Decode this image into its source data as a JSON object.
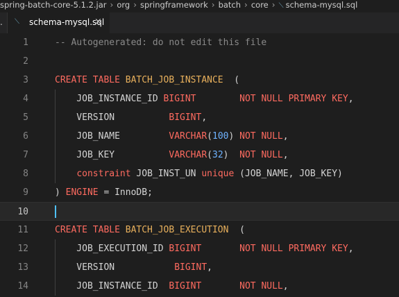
{
  "breadcrumb": {
    "items": [
      {
        "label": "spring-batch-core-5.1.2.jar"
      },
      {
        "label": "org"
      },
      {
        "label": "springframework"
      },
      {
        "label": "batch"
      },
      {
        "label": "core"
      },
      {
        "label": "schema-mysql.sql"
      }
    ],
    "separator": "›"
  },
  "tabs": {
    "overflow": ".",
    "active": {
      "label": "schema-mysql.sql",
      "close": "×"
    }
  },
  "editor": {
    "active_line": 10,
    "colors": {
      "comment": "#8a8a8a",
      "keyword": "#ff6b60",
      "name": "#e8b05c",
      "number": "#6fb3ff",
      "plain": "#d4d4d4",
      "cursor": "#4fc1ff"
    },
    "lines": [
      {
        "number": "1",
        "tokens": [
          {
            "t": "comment",
            "v": "-- Autogenerated: do not edit this file"
          }
        ]
      },
      {
        "number": "2",
        "tokens": []
      },
      {
        "number": "3",
        "tokens": [
          {
            "t": "kw",
            "v": "CREATE TABLE "
          },
          {
            "t": "name",
            "v": "BATCH_JOB_INSTANCE"
          },
          {
            "t": "plain",
            "v": "  ("
          }
        ]
      },
      {
        "number": "4",
        "tokens": [
          {
            "t": "plain",
            "v": "    JOB_INSTANCE_ID "
          },
          {
            "t": "kw",
            "v": "BIGINT"
          },
          {
            "t": "plain",
            "v": "        "
          },
          {
            "t": "kw",
            "v": "NOT NULL PRIMARY KEY"
          },
          {
            "t": "plain",
            "v": ","
          }
        ]
      },
      {
        "number": "5",
        "tokens": [
          {
            "t": "plain",
            "v": "    VERSION          "
          },
          {
            "t": "kw",
            "v": "BIGINT"
          },
          {
            "t": "plain",
            "v": ","
          }
        ]
      },
      {
        "number": "6",
        "tokens": [
          {
            "t": "plain",
            "v": "    JOB_NAME         "
          },
          {
            "t": "kw",
            "v": "VARCHAR"
          },
          {
            "t": "plain",
            "v": "("
          },
          {
            "t": "num",
            "v": "100"
          },
          {
            "t": "plain",
            "v": ") "
          },
          {
            "t": "kw",
            "v": "NOT NULL"
          },
          {
            "t": "plain",
            "v": ","
          }
        ]
      },
      {
        "number": "7",
        "tokens": [
          {
            "t": "plain",
            "v": "    JOB_KEY          "
          },
          {
            "t": "kw",
            "v": "VARCHAR"
          },
          {
            "t": "plain",
            "v": "("
          },
          {
            "t": "num",
            "v": "32"
          },
          {
            "t": "plain",
            "v": ")  "
          },
          {
            "t": "kw",
            "v": "NOT NULL"
          },
          {
            "t": "plain",
            "v": ","
          }
        ]
      },
      {
        "number": "8",
        "tokens": [
          {
            "t": "plain",
            "v": "    "
          },
          {
            "t": "kw",
            "v": "constraint"
          },
          {
            "t": "plain",
            "v": " JOB_INST_UN "
          },
          {
            "t": "kw",
            "v": "unique"
          },
          {
            "t": "plain",
            "v": " (JOB_NAME, JOB_KEY)"
          }
        ]
      },
      {
        "number": "9",
        "tokens": [
          {
            "t": "plain",
            "v": ") "
          },
          {
            "t": "kw",
            "v": "ENGINE"
          },
          {
            "t": "plain",
            "v": " = InnoDB;"
          }
        ]
      },
      {
        "number": "10",
        "tokens": []
      },
      {
        "number": "11",
        "tokens": [
          {
            "t": "kw",
            "v": "CREATE TABLE "
          },
          {
            "t": "name",
            "v": "BATCH_JOB_EXECUTION"
          },
          {
            "t": "plain",
            "v": "  ("
          }
        ]
      },
      {
        "number": "12",
        "tokens": [
          {
            "t": "plain",
            "v": "    JOB_EXECUTION_ID "
          },
          {
            "t": "kw",
            "v": "BIGINT"
          },
          {
            "t": "plain",
            "v": "       "
          },
          {
            "t": "kw",
            "v": "NOT NULL PRIMARY KEY"
          },
          {
            "t": "plain",
            "v": ","
          }
        ]
      },
      {
        "number": "13",
        "tokens": [
          {
            "t": "plain",
            "v": "    VERSION           "
          },
          {
            "t": "kw",
            "v": "BIGINT"
          },
          {
            "t": "plain",
            "v": ","
          }
        ]
      },
      {
        "number": "14",
        "tokens": [
          {
            "t": "plain",
            "v": "    JOB_INSTANCE_ID  "
          },
          {
            "t": "kw",
            "v": "BIGINT"
          },
          {
            "t": "plain",
            "v": "       "
          },
          {
            "t": "kw",
            "v": "NOT NULL"
          },
          {
            "t": "plain",
            "v": ","
          }
        ]
      }
    ]
  }
}
